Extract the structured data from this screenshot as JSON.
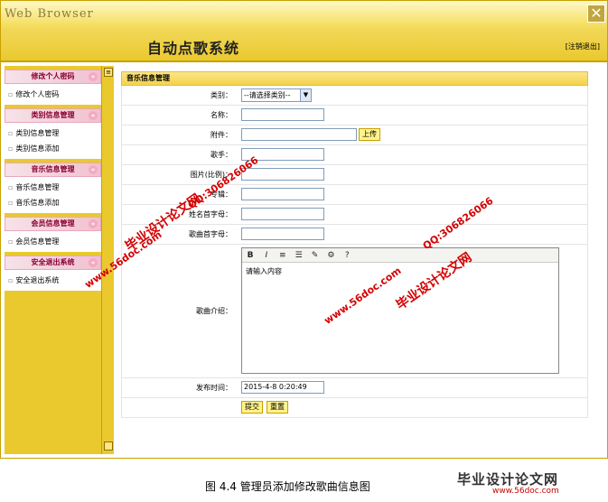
{
  "window": {
    "title": "Web Browser",
    "close_glyph": "✕"
  },
  "header": {
    "system_title": "自动点歌系统",
    "logout": "[注销退出]"
  },
  "sidebar": {
    "sections": [
      {
        "head": "修改个人密码",
        "items": [
          "修改个人密码"
        ]
      },
      {
        "head": "类别信息管理",
        "items": [
          "类别信息管理",
          "类别信息添加"
        ]
      },
      {
        "head": "音乐信息管理",
        "items": [
          "音乐信息管理",
          "音乐信息添加"
        ]
      },
      {
        "head": "会员信息管理",
        "items": [
          "会员信息管理"
        ]
      },
      {
        "head": "安全退出系统",
        "items": [
          "安全退出系统"
        ]
      }
    ]
  },
  "panel": {
    "title": "音乐信息管理"
  },
  "form": {
    "category_label": "类别：",
    "category_value": "--请选择类别--",
    "name_label": "名称：",
    "attachment_label": "附件：",
    "upload_button": "上传",
    "singer_label": "歌手：",
    "photo_label": "图片(比例)：",
    "album_label": "专辑：",
    "initial_label": "姓名首字母：",
    "song_initial_label": "歌曲首字母：",
    "intro_label": "歌曲介绍：",
    "editor_placeholder": "请输入内容",
    "time_label": "发布时间：",
    "time_value": "2015-4-8 0:20:49",
    "submit_button": "提交",
    "reset_button": "重置"
  },
  "editor_toolbar": [
    "B",
    "I",
    "≡",
    "☰",
    "✎",
    "⚙",
    "?"
  ],
  "watermarks": {
    "site_name": "毕业设计论文网",
    "site_url": "www.56doc.com",
    "qq": "QQ:306826066"
  },
  "caption": "图 4.4  管理员添加修改歌曲信息图",
  "footer_logo": "毕业设计论文网",
  "footer_url": "www.56doc.com"
}
